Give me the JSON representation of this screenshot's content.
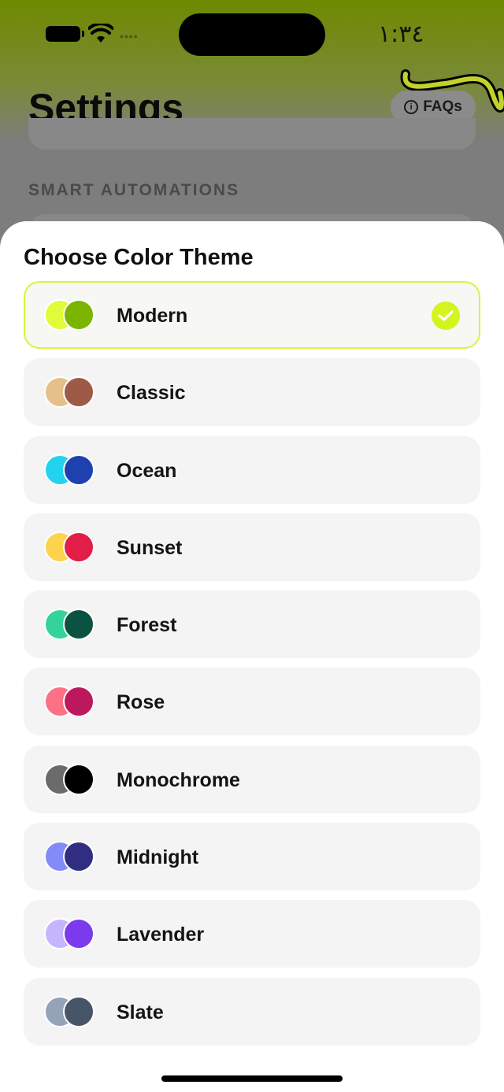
{
  "status_bar": {
    "time": "١:٣٤",
    "signal_icon": "cellular-dots-icon",
    "wifi_icon": "wifi-icon",
    "battery_icon": "battery-icon"
  },
  "background_screen": {
    "title": "Settings",
    "faq_button": {
      "label": "FAQs",
      "icon": "info-icon"
    },
    "section_header": "SMART AUTOMATIONS"
  },
  "sheet": {
    "title": "Choose Color Theme",
    "check_color": "#d4f41f",
    "themes": [
      {
        "label": "Modern",
        "color_a": "#e0fb3a",
        "color_b": "#7cb500",
        "selected": true
      },
      {
        "label": "Classic",
        "color_a": "#e6c08a",
        "color_b": "#9d5b47",
        "selected": false
      },
      {
        "label": "Ocean",
        "color_a": "#23d3ee",
        "color_b": "#1f41b0",
        "selected": false
      },
      {
        "label": "Sunset",
        "color_a": "#fcd34d",
        "color_b": "#e11d48",
        "selected": false
      },
      {
        "label": "Forest",
        "color_a": "#34d399",
        "color_b": "#0b5340",
        "selected": false
      },
      {
        "label": "Rose",
        "color_a": "#fb7185",
        "color_b": "#be185d",
        "selected": false
      },
      {
        "label": "Monochrome",
        "color_a": "#6b6b6b",
        "color_b": "#000000",
        "selected": false
      },
      {
        "label": "Midnight",
        "color_a": "#818cf8",
        "color_b": "#312e81",
        "selected": false
      },
      {
        "label": "Lavender",
        "color_a": "#c4b5fd",
        "color_b": "#7c3aed",
        "selected": false
      },
      {
        "label": "Slate",
        "color_a": "#94a3b8",
        "color_b": "#475569",
        "selected": false
      }
    ]
  }
}
